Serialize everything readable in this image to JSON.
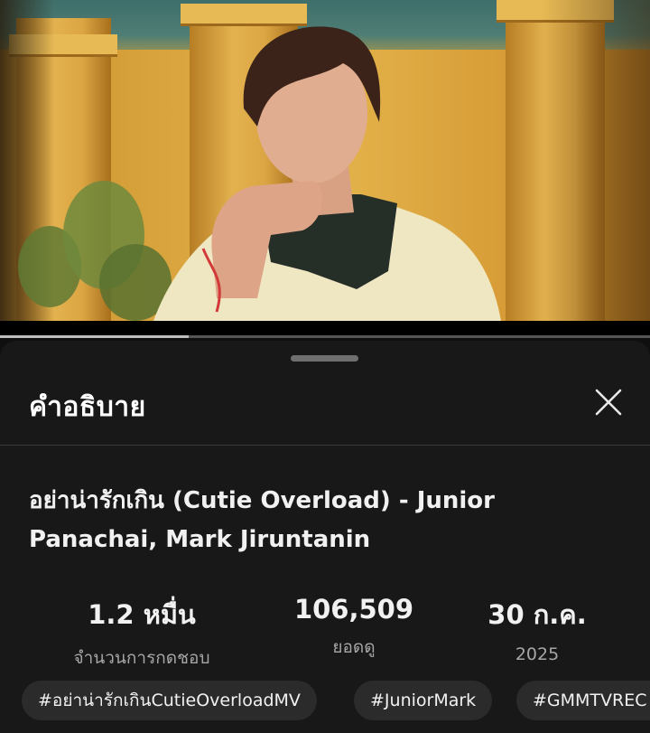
{
  "video": {
    "progress_fraction": 0.29
  },
  "description_panel": {
    "title": "คำอธิบาย",
    "close_icon": "close-icon",
    "video_title": "อย่าน่ารักเกิน (Cutie Overload) - Junior Panachai, Mark Jiruntanin",
    "stats": [
      {
        "value": "1.2 หมื่น",
        "label": "จำนวนการกดชอบ"
      },
      {
        "value": "106,509",
        "label": "ยอดดู"
      },
      {
        "value": "30 ก.ค.",
        "label": "2025"
      }
    ],
    "hashtags": [
      "#อย่าน่ารักเกินCutieOverloadMV",
      "#JuniorMark",
      "#GMMTVREC"
    ]
  },
  "colors": {
    "background": "#0f0f0f",
    "sheet": "#181818",
    "chip": "#2b2b2b",
    "secondary_text": "#a6a6a6"
  }
}
